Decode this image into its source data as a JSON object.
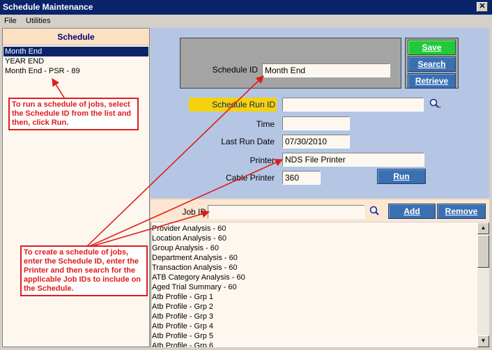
{
  "window": {
    "title": "Schedule Maintenance",
    "close": "✕"
  },
  "menu": {
    "file": "File",
    "utilities": "Utilities"
  },
  "schedule_panel": {
    "header": "Schedule",
    "items": [
      "Month End",
      "YEAR END",
      "Month End - PSR - 89"
    ]
  },
  "form": {
    "schedule_id_label": "Schedule ID",
    "schedule_id_value": "Month End",
    "schedule_run_id_label": "Schedule Run ID",
    "schedule_run_id_value": "",
    "time_label": "Time",
    "time_value": "",
    "last_run_date_label": "Last Run Date",
    "last_run_date_value": "07/30/2010",
    "printer_label": "Printer",
    "printer_value": "NDS File Printer",
    "cable_printer_label": "Cable Printer",
    "cable_printer_value": "360"
  },
  "buttons": {
    "save": "Save",
    "search": "Search",
    "retrieve": "Retrieve",
    "run": "Run",
    "add": "Add",
    "remove": "Remove"
  },
  "job": {
    "label": "Job ID",
    "value": "",
    "items": [
      "Provider Analysis - 60",
      "Location Analysis - 60",
      "Group Analysis - 60",
      "Department Analysis - 60",
      "Transaction Analysis - 60",
      "ATB Category Analysis - 60",
      "Aged Trial Summary - 60",
      "Atb Profile - Grp 1",
      "Atb Profile - Grp 2",
      "Atb Profile - Grp 3",
      "Atb Profile - Grp 4",
      "Atb Profile - Grp 5",
      "Atb Profile - Grp 6"
    ]
  },
  "callouts": {
    "run": "To run a schedule of jobs, select the Schedule ID from the list and then, click Run.",
    "create": "To create a schedule of jobs, enter the Schedule ID, enter the Printer and then search for the applicable Job IDs to include on the Schedule."
  },
  "colors": {
    "title_bar": "#0a246a",
    "button_blue": "#3a70b2",
    "button_green": "#22c93a",
    "callout_red": "#e01b1b",
    "form_bg": "#b4c6e4",
    "run_id_highlight": "#f4d20e"
  },
  "icons": {
    "lookup": "magnifier-icon",
    "scroll_up": "arrow-up-icon",
    "scroll_down": "arrow-down-icon"
  }
}
